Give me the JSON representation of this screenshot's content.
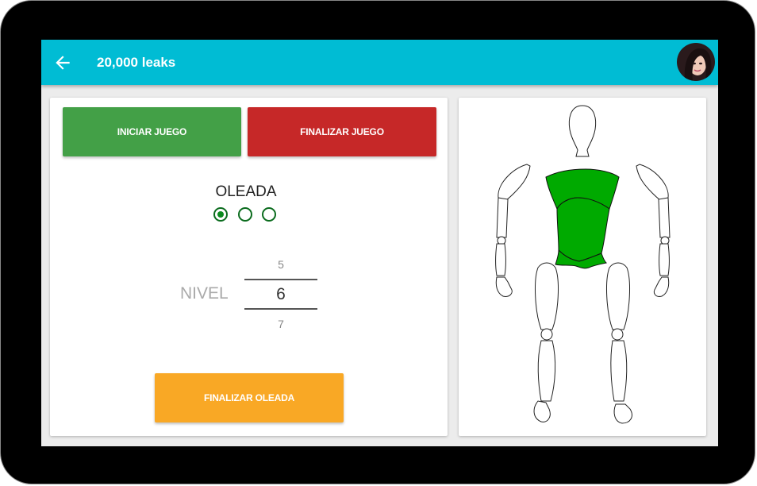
{
  "appbar": {
    "title": "20,000 leaks",
    "back_icon": "arrow-left-icon",
    "accent": "#00bcd4"
  },
  "controls": {
    "start_label": "INICIAR JUEGO",
    "end_label": "FINALIZAR JUEGO",
    "start_color": "#43a047",
    "end_color": "#c62828"
  },
  "wave": {
    "label": "OLEADA",
    "options_count": 3,
    "selected_index": 0,
    "finish_label": "FINALIZAR OLEADA",
    "finish_color": "#f9a825"
  },
  "level": {
    "label": "NIVEL",
    "prev": "5",
    "current": "6",
    "next": "7"
  },
  "body_map": {
    "highlighted_part": "torso",
    "highlight_color": "#00aa00"
  }
}
